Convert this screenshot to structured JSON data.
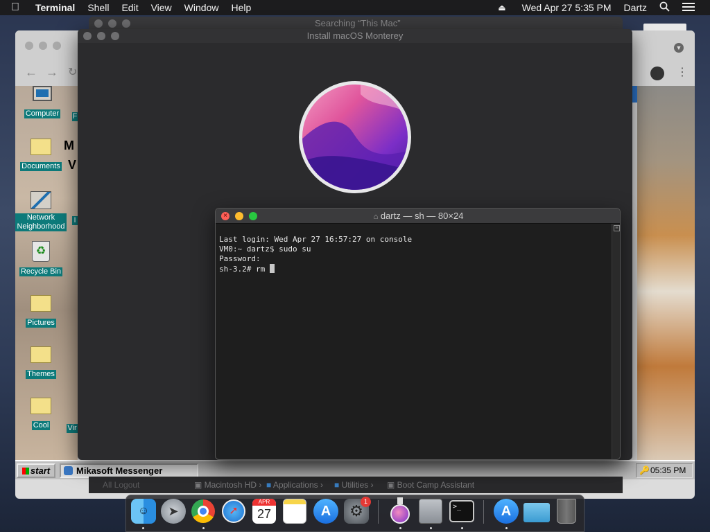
{
  "menubar": {
    "apple": "",
    "app": "Terminal",
    "items": [
      "Shell",
      "Edit",
      "View",
      "Window",
      "Help"
    ],
    "datetime": "Wed Apr 27  5:35 PM",
    "user": "Dartz"
  },
  "finder_bg": {
    "title": "Searching “This Mac”"
  },
  "installer": {
    "title": "Install macOS Monterey"
  },
  "browser_bg": {
    "title": ""
  },
  "desktop98": {
    "icons": [
      {
        "label": "Computer"
      },
      {
        "label": "Documents"
      },
      {
        "label": "Network Neighborhood"
      },
      {
        "label": "Recycle Bin"
      },
      {
        "label": "Pictures"
      },
      {
        "label": "Themes"
      },
      {
        "label": "Cool"
      }
    ],
    "side_labels": [
      "F",
      "M",
      "V",
      "I",
      "Vir"
    ],
    "taskbar": {
      "start": "start",
      "task": "Mikasoft Messenger",
      "clock": "05:35 PM"
    }
  },
  "terminal": {
    "title": "dartz — sh — 80×24",
    "lines": [
      "Last login: Wed Apr 27 16:57:27 on console",
      "VM0:~ dartz$ sudo su",
      "Password:",
      "sh-3.2# rm "
    ]
  },
  "pathbar": {
    "items": [
      "Macintosh HD",
      "Applications",
      "Utilities",
      "Boot Camp Assistant"
    ],
    "behind": "All Logout"
  },
  "dock": {
    "apps": [
      {
        "name": "Finder"
      },
      {
        "name": "Launchpad"
      },
      {
        "name": "Chrome"
      },
      {
        "name": "Safari"
      },
      {
        "name": "Calendar",
        "month": "APR",
        "day": "27"
      },
      {
        "name": "Notes"
      },
      {
        "name": "App Store"
      },
      {
        "name": "System Preferences",
        "badge": "1"
      },
      {
        "name": "Install macOS Monterey"
      },
      {
        "name": "Archive Utility"
      },
      {
        "name": "Terminal",
        "glyph": ">_"
      },
      {
        "name": "App Store Downloads"
      },
      {
        "name": "Folder"
      },
      {
        "name": "Trash"
      }
    ]
  },
  "colors": {
    "accent": "#0d7a7a",
    "terminal_bg": "#1e1e1e",
    "menubar_bg": "#1c1c1e"
  }
}
